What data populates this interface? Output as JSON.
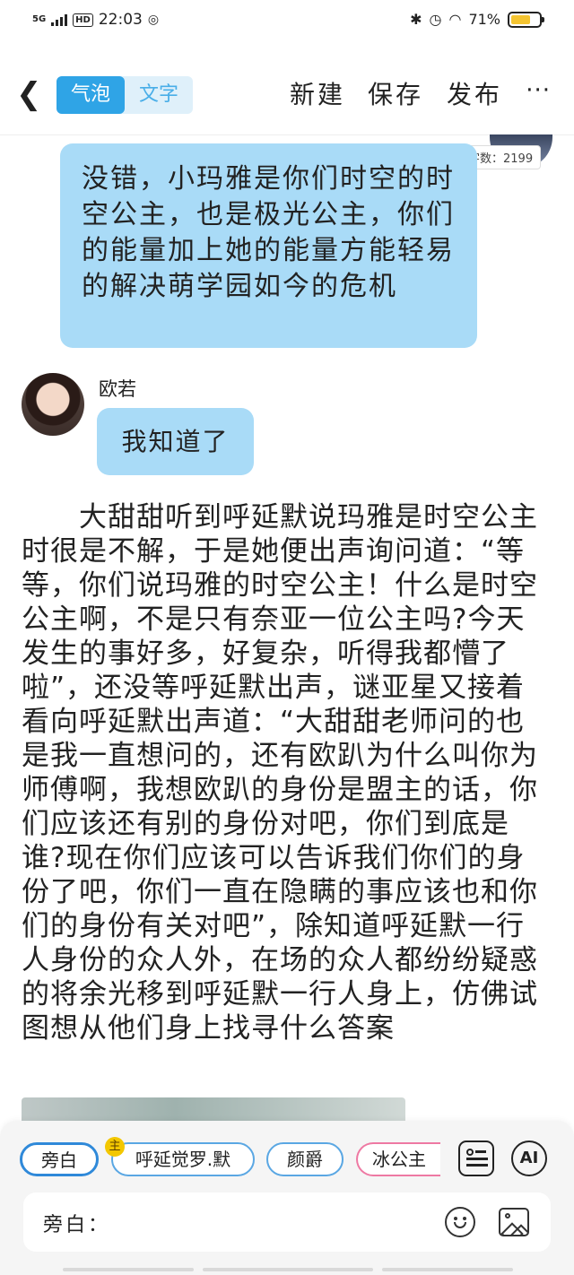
{
  "status_bar": {
    "network": "5G",
    "hd": "HD",
    "time": "22:03",
    "battery": "71%",
    "battery_level": 0.71
  },
  "header": {
    "back_icon": "chevron-left",
    "tabs": [
      {
        "label": "气泡",
        "active": true
      },
      {
        "label": "文字",
        "active": false
      }
    ],
    "new_label": "新建",
    "save_label": "保存",
    "publish_label": "发布",
    "more_label": "···"
  },
  "word_count": "字数：2199",
  "messages": [
    {
      "type": "bubble",
      "text": "没错，小玛雅是你们时空的时空公主，也是极光公主，你们的能量加上她的能量方能轻易的解决萌学园如今的危机"
    },
    {
      "type": "bubble",
      "speaker": "欧若",
      "text": "我知道了"
    }
  ],
  "narration": "大甜甜听到呼延默说玛雅是时空公主时很是不解，于是她便出声询问道：“等等，你们说玛雅的时空公主！什么是时空公主啊，不是只有奈亚一位公主吗?今天发生的事好多，好复杂，听得我都懵了啦”，还没等呼延默出声，谜亚星又接着看向呼延默出声道：“大甜甜老师问的也是我一直想问的，还有欧趴为什么叫你为师傅啊，我想欧趴的身份是盟主的话，你们应该还有别的身份对吧，你们到底是谁?现在你们应该可以告诉我们你们的身份了吧，你们一直在隐瞒的事应该也和你们的身份有关对吧”，除知道呼延默一行人身份的众人外，在场的众人都纷纷疑惑的将余光移到呼延默一行人身上，仿佛试图想从他们身上找寻什么答案",
  "roles": [
    {
      "label": "旁白",
      "selected": true
    },
    {
      "label": "呼延觉罗.默",
      "badge": "主"
    },
    {
      "label": "颜爵"
    },
    {
      "label": "冰公主"
    }
  ],
  "tools": {
    "card_icon": "contact-card-icon",
    "ai_label": "AI"
  },
  "input": {
    "label": "旁白："
  },
  "colors": {
    "accent": "#2fa4e6",
    "bubble": "#a9dbf7",
    "pink": "#ee79a3"
  }
}
